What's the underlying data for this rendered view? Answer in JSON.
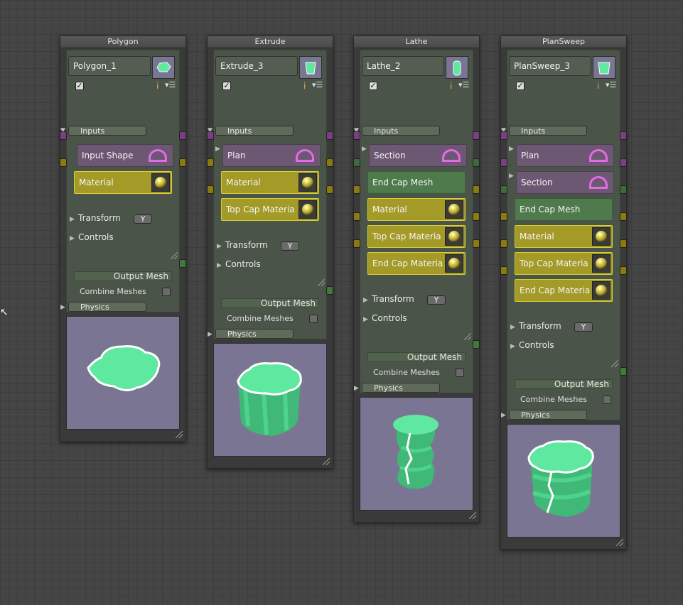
{
  "nodes": [
    {
      "title": "Polygon",
      "name": "Polygon_1",
      "inputs_label": "Inputs",
      "slots": [
        {
          "label": "Input Shape",
          "kind": "shape"
        },
        {
          "label": "Material",
          "kind": "mat"
        }
      ],
      "transform_label": "Transform",
      "axis_label": "Y",
      "controls_label": "Controls",
      "output_label": "Output Mesh",
      "combine_label": "Combine Meshes",
      "physics_label": "Physics"
    },
    {
      "title": "Extrude",
      "name": "Extrude_3",
      "inputs_label": "Inputs",
      "slots": [
        {
          "label": "Plan",
          "kind": "shape"
        },
        {
          "label": "Material",
          "kind": "mat"
        },
        {
          "label": "Top Cap Materia",
          "kind": "mat"
        }
      ],
      "transform_label": "Transform",
      "axis_label": "Y",
      "controls_label": "Controls",
      "output_label": "Output Mesh",
      "combine_label": "Combine Meshes",
      "physics_label": "Physics"
    },
    {
      "title": "Lathe",
      "name": "Lathe_2",
      "inputs_label": "Inputs",
      "slots": [
        {
          "label": "Section",
          "kind": "shape"
        },
        {
          "label": "End Cap Mesh",
          "kind": "mesh"
        },
        {
          "label": "Material",
          "kind": "mat"
        },
        {
          "label": "Top Cap Materia",
          "kind": "mat"
        },
        {
          "label": "End Cap Materia",
          "kind": "mat"
        }
      ],
      "transform_label": "Transform",
      "axis_label": "Y",
      "controls_label": "Controls",
      "output_label": "Output Mesh",
      "combine_label": "Combine Meshes",
      "physics_label": "Physics"
    },
    {
      "title": "PlanSweep",
      "name": "PlanSweep_3",
      "inputs_label": "Inputs",
      "slots": [
        {
          "label": "Plan",
          "kind": "shape"
        },
        {
          "label": "Section",
          "kind": "shape"
        },
        {
          "label": "End Cap Mesh",
          "kind": "mesh"
        },
        {
          "label": "Material",
          "kind": "mat"
        },
        {
          "label": "Top Cap Materia",
          "kind": "mat"
        },
        {
          "label": "End Cap Materia",
          "kind": "mat"
        }
      ],
      "transform_label": "Transform",
      "axis_label": "Y",
      "controls_label": "Controls",
      "output_label": "Output Mesh",
      "combine_label": "Combine Meshes",
      "physics_label": "Physics"
    }
  ],
  "icons": {
    "checkmark": "✓",
    "info": "i",
    "menu": "▾☰",
    "expand": "▶",
    "expanded": "▼"
  },
  "colors": {
    "canvas": "#454545",
    "node_body": "#4a5448",
    "shape_slot": "#6d5873",
    "material_slot": "#a39a28",
    "mesh_slot": "#4e7a4c",
    "preview_bg": "#7a7592",
    "mesh_green": "#5fe8a0"
  }
}
